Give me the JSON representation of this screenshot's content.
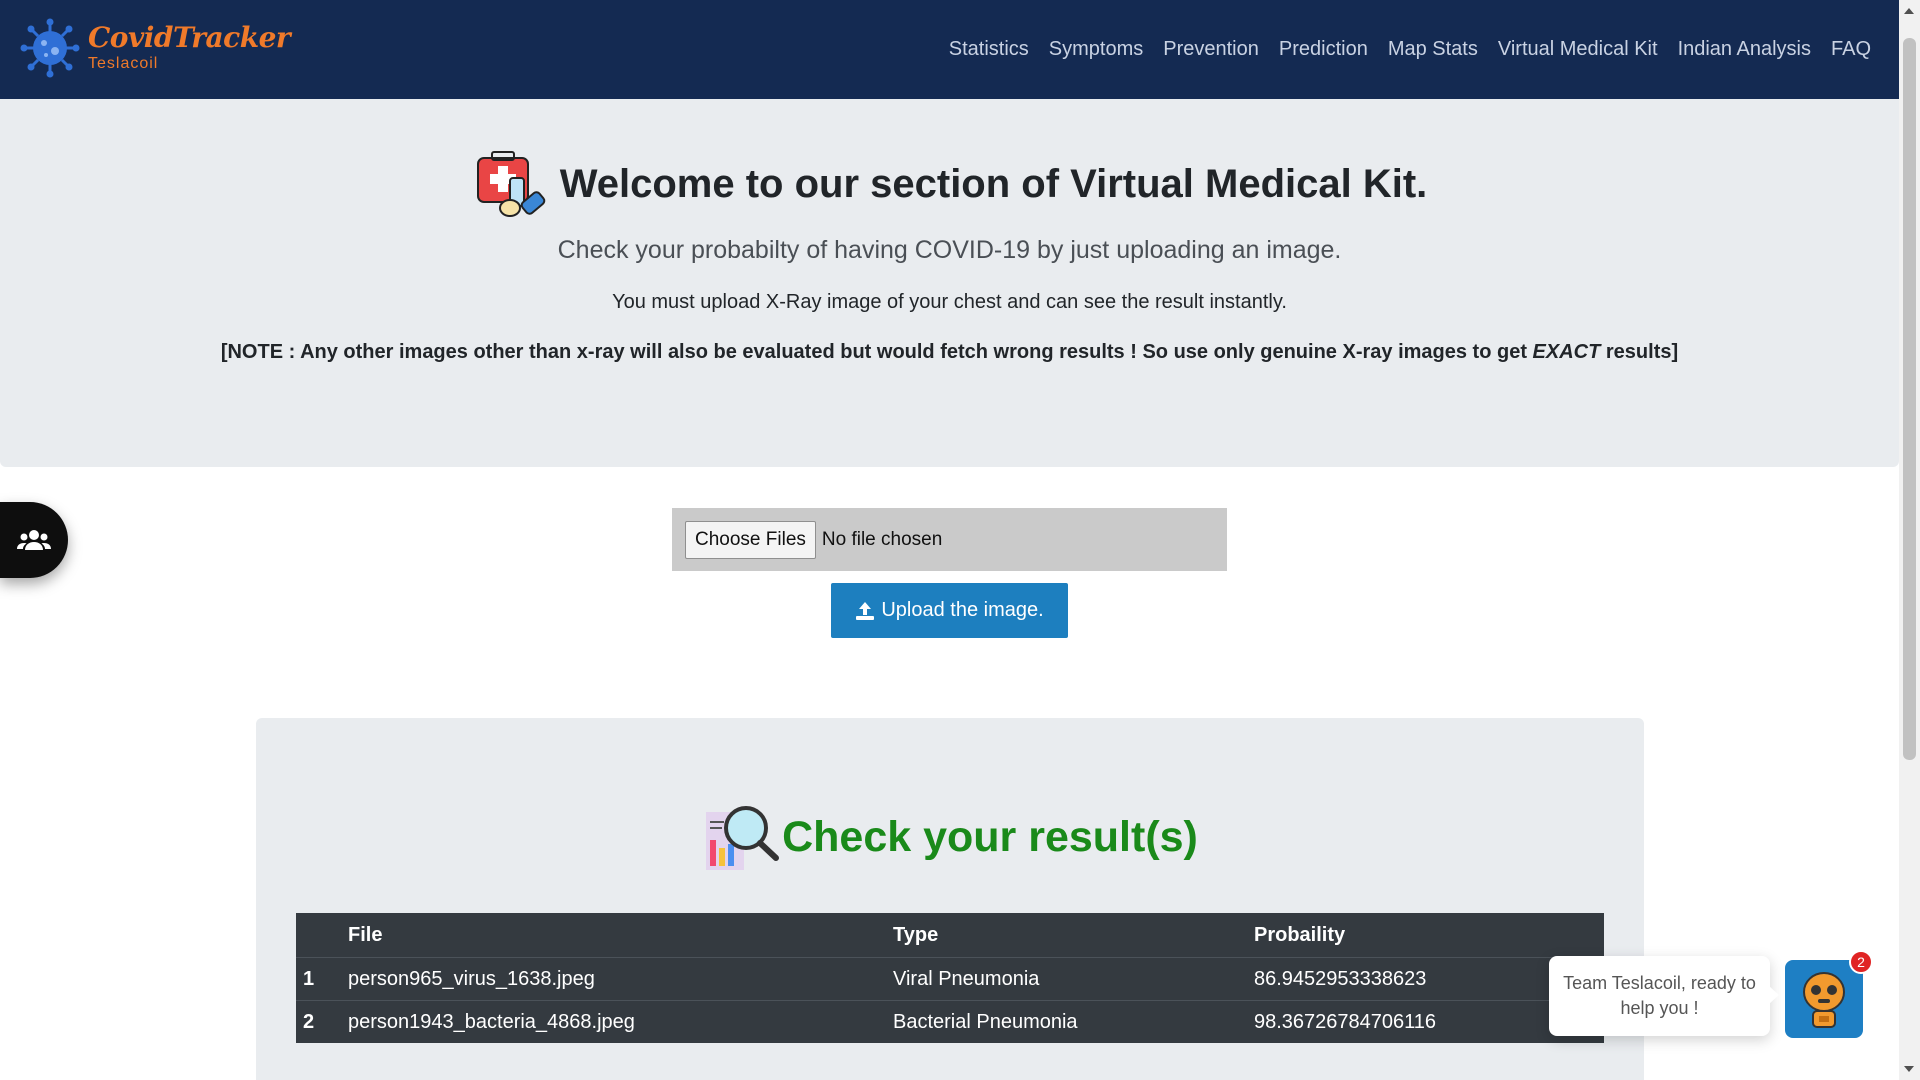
{
  "brand": {
    "title": "CovidTracker",
    "subtitle": "Teslacoil"
  },
  "nav": [
    "Statistics",
    "Symptoms",
    "Prevention",
    "Prediction",
    "Map Stats",
    "Virtual Medical Kit",
    "Indian Analysis",
    "FAQ"
  ],
  "hero": {
    "title": "Welcome to our section of Virtual Medical Kit.",
    "lead": "Check your probabilty of having COVID-19 by just uploading an image.",
    "info": "You must upload X-Ray image of your chest and can see the result instantly.",
    "note_prefix": "[NOTE : Any other images other than x-ray will also be evaluated but would fetch wrong results ! So use only genuine X-ray images to get ",
    "note_emphasis": "EXACT",
    "note_suffix": " results]"
  },
  "upload": {
    "choose_label": "Choose Files",
    "file_status": "No file chosen",
    "button_label": "Upload the image."
  },
  "results": {
    "title": "Check your result(s)",
    "columns": [
      "",
      "File",
      "Type",
      "Probaility"
    ],
    "rows": [
      {
        "num": "1",
        "file": "person965_virus_1638.jpeg",
        "type": "Viral Pneumonia",
        "probability": "86.9452953338623"
      },
      {
        "num": "2",
        "file": "person1943_bacteria_4868.jpeg",
        "type": "Bacterial Pneumonia",
        "probability": "98.36726784706116"
      }
    ]
  },
  "chat": {
    "message": "Team Teslacoil, ready to help you !",
    "badge": "2"
  },
  "colors": {
    "navbar": "#142a52",
    "brand": "#f07a2a",
    "upload_button": "#1d7fbf",
    "results_title": "#1a8a1a",
    "table": "#343a40"
  }
}
